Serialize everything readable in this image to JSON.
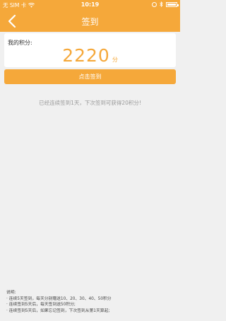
{
  "status_bar": {
    "carrier": "无 SIM 卡",
    "time": "10:19"
  },
  "nav": {
    "title": "签到",
    "back_icon": "chevron-left-icon"
  },
  "points": {
    "label": "我的积分:",
    "value": "2220",
    "unit": "分"
  },
  "signin_button": {
    "label": "点击签到"
  },
  "status_message": "已经连续签到1天，下次签到可获得20积分!",
  "notes": {
    "title": "说明:",
    "items": [
      "· 连续5天签到，每天分别赠送10、20、30、40、50积分",
      "· 连续签到5天后，每天签到送50积分;",
      "· 连续签到5天后，如果忘记签到，下次签到从第1天算起;"
    ]
  },
  "colors": {
    "accent": "#f5a83a",
    "background": "#f0f0f0",
    "muted_text": "#9a9a9a"
  }
}
